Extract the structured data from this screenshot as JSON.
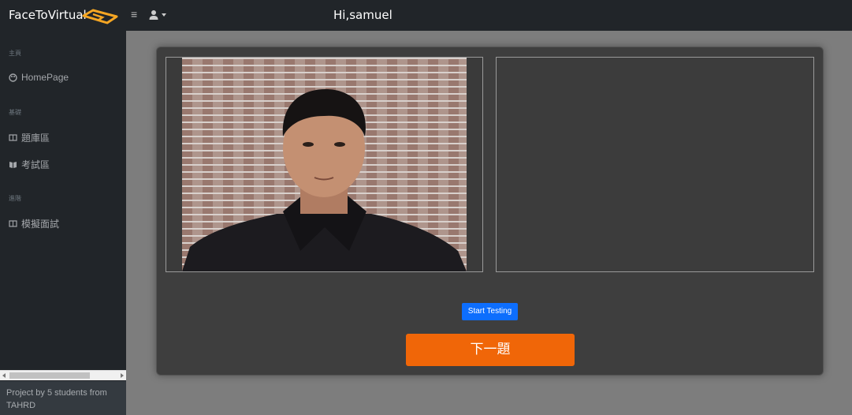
{
  "app": {
    "brand": "FaceToVirtual",
    "greeting": "Hi,samuel"
  },
  "icons": {
    "menu": "hamburger-icon",
    "user": "user-icon",
    "caret": "caret-down-icon",
    "logo": "brand-logo"
  },
  "sidebar": {
    "sections": [
      {
        "heading": "主頁",
        "items": [
          {
            "label": "HomePage",
            "icon": "palette-icon"
          }
        ]
      },
      {
        "heading": "基礎",
        "items": [
          {
            "label": "題庫區",
            "icon": "table-icon"
          },
          {
            "label": "考試區",
            "icon": "book-icon"
          }
        ]
      },
      {
        "heading": "進階",
        "items": [
          {
            "label": "模擬面試",
            "icon": "table-icon"
          }
        ]
      }
    ],
    "footer": "Project by 5 students from TAHRD"
  },
  "main": {
    "start_button": "Start Testing",
    "next_button": "下一題"
  },
  "colors": {
    "accent_orange": "#f06608",
    "primary_blue": "#0d6efd",
    "sidebar_bg": "#212529"
  }
}
